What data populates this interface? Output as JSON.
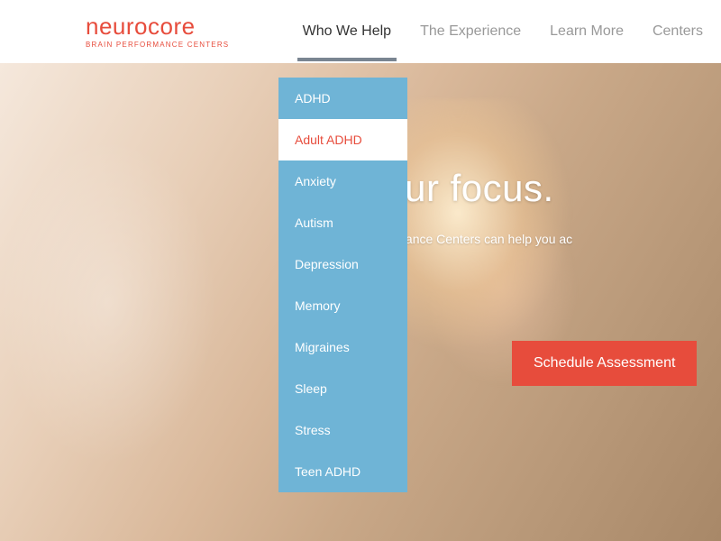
{
  "logo": {
    "text": "neurocore",
    "tagline": "BRAIN PERFORMANCE CENTERS"
  },
  "nav": {
    "items": [
      {
        "label": "Who We Help",
        "active": true
      },
      {
        "label": "The Experience",
        "active": false
      },
      {
        "label": "Learn More",
        "active": false
      },
      {
        "label": "Centers",
        "active": false
      }
    ]
  },
  "dropdown": {
    "items": [
      {
        "label": "ADHD",
        "selected": false
      },
      {
        "label": "Adult ADHD",
        "selected": true
      },
      {
        "label": "Anxiety",
        "selected": false
      },
      {
        "label": "Autism",
        "selected": false
      },
      {
        "label": "Depression",
        "selected": false
      },
      {
        "label": "Memory",
        "selected": false
      },
      {
        "label": "Migraines",
        "selected": false
      },
      {
        "label": "Sleep",
        "selected": false
      },
      {
        "label": "Stress",
        "selected": false
      },
      {
        "label": "Teen ADHD",
        "selected": false
      }
    ]
  },
  "hero": {
    "title_fragment": "pen your focus.",
    "subtitle_fragment": "rocore Brain Performance Centers can help you ac"
  },
  "cta": {
    "label": "Schedule Assessment"
  },
  "colors": {
    "brand_red": "#e74c3c",
    "dropdown_blue": "#6fb4d6",
    "nav_inactive": "#999999",
    "nav_active": "#333333"
  }
}
